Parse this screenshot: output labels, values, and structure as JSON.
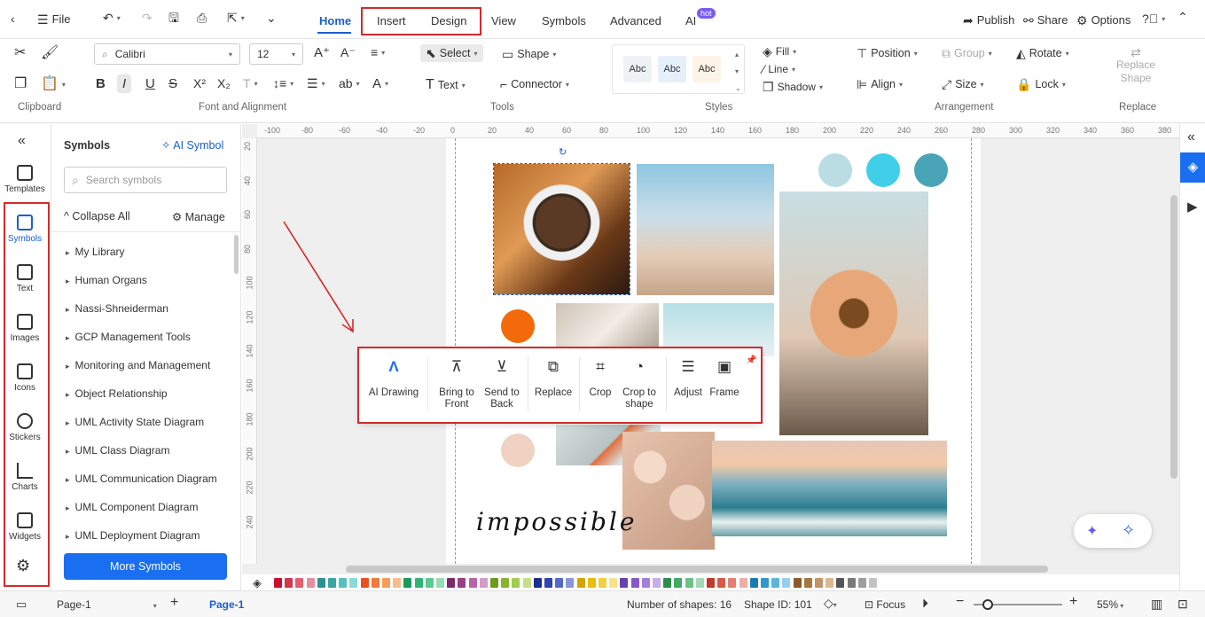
{
  "menu": {
    "file": "File"
  },
  "tabs": [
    {
      "label": "Home"
    },
    {
      "label": "Insert"
    },
    {
      "label": "Design"
    },
    {
      "label": "View"
    },
    {
      "label": "Symbols"
    },
    {
      "label": "Advanced"
    },
    {
      "label": "AI"
    }
  ],
  "ai_badge": "hot",
  "top_right": {
    "publish": "Publish",
    "share": "Share",
    "options": "Options"
  },
  "ribbon": {
    "font_name": "Calibri",
    "font_size": "12",
    "select": "Select",
    "shape": "Shape",
    "text": "Text",
    "connector": "Connector",
    "style_samples": [
      "Abc",
      "Abc",
      "Abc"
    ],
    "fill": "Fill",
    "line": "Line",
    "shadow": "Shadow",
    "position": "Position",
    "group": "Group",
    "rotate": "Rotate",
    "align": "Align",
    "size": "Size",
    "lock": "Lock",
    "replace_shape": "Replace Shape",
    "groups": {
      "clipboard": "Clipboard",
      "font": "Font and Alignment",
      "tools": "Tools",
      "styles": "Styles",
      "arrangement": "Arrangement",
      "replace": "Replace"
    }
  },
  "leftbar": [
    {
      "label": "Templates"
    },
    {
      "label": "Symbols"
    },
    {
      "label": "Text"
    },
    {
      "label": "Images"
    },
    {
      "label": "Icons"
    },
    {
      "label": "Stickers"
    },
    {
      "label": "Charts"
    },
    {
      "label": "Widgets"
    }
  ],
  "panel": {
    "title": "Symbols",
    "ai_symbol": "AI Symbol",
    "search_placeholder": "Search symbols",
    "collapse_all": "Collapse All",
    "manage": "Manage",
    "items": [
      "My Library",
      "Human Organs",
      "Nassi-Shneiderman",
      "GCP Management Tools",
      "Monitoring and Management",
      "Object Relationship",
      "UML Activity State Diagram",
      "UML Class Diagram",
      "UML Communication Diagram",
      "UML Component Diagram",
      "UML Deployment Diagram"
    ],
    "more_button": "More Symbols"
  },
  "ruler_h": [
    "-100",
    "-80",
    "-60",
    "-40",
    "-20",
    "0",
    "20",
    "40",
    "60",
    "80",
    "100",
    "120",
    "140",
    "160",
    "180",
    "200",
    "220",
    "240",
    "260",
    "280",
    "300",
    "320",
    "340",
    "360",
    "380"
  ],
  "ruler_v": [
    "20",
    "40",
    "60",
    "80",
    "100",
    "120",
    "140",
    "160",
    "180",
    "200",
    "220",
    "240"
  ],
  "canvas": {
    "handwriting": "impossible"
  },
  "floatbar": [
    {
      "label": "AI Drawing"
    },
    {
      "label": "Bring to Front"
    },
    {
      "label": "Send to Back"
    },
    {
      "label": "Replace"
    },
    {
      "label": "Crop"
    },
    {
      "label": "Crop to shape"
    },
    {
      "label": "Adjust"
    },
    {
      "label": "Frame"
    }
  ],
  "status": {
    "page_select": "Page-1",
    "page_tab": "Page-1",
    "shapes": "Number of shapes: 16",
    "shape_id": "Shape ID: 101",
    "focus": "Focus",
    "zoom": "55%"
  },
  "palette": [
    "#c8102e",
    "#d4374a",
    "#e06070",
    "#e38fa0",
    "#2f8f8f",
    "#3aa5a5",
    "#55c0c0",
    "#8ad8d8",
    "#e8501e",
    "#ef7a3c",
    "#f39c5c",
    "#f6bd8c",
    "#1a9b5a",
    "#2fb473",
    "#5cc894",
    "#97dcb6",
    "#7a2a6a",
    "#9a3f87",
    "#b864a5",
    "#d49ac8",
    "#6e9a1e",
    "#86b42c",
    "#a3cc4e",
    "#c4df86",
    "#1e2f8f",
    "#3045b0",
    "#5568cc",
    "#8896de",
    "#d4a400",
    "#e8bc10",
    "#f2d040",
    "#f7e28a",
    "#6a3fb0",
    "#8559c8",
    "#a37fd8",
    "#c6aee8",
    "#2e8b4e",
    "#45a866",
    "#6cc287",
    "#a2dab4",
    "#c0392b",
    "#d9584a",
    "#e57f73",
    "#efada6",
    "#1a7ab0",
    "#2f98cc",
    "#5bb4dc",
    "#94d0ec",
    "#8a5a2b",
    "#a87543",
    "#c49468",
    "#dbb894",
    "#555555",
    "#7a7a7a",
    "#9e9e9e",
    "#c4c4c4"
  ]
}
